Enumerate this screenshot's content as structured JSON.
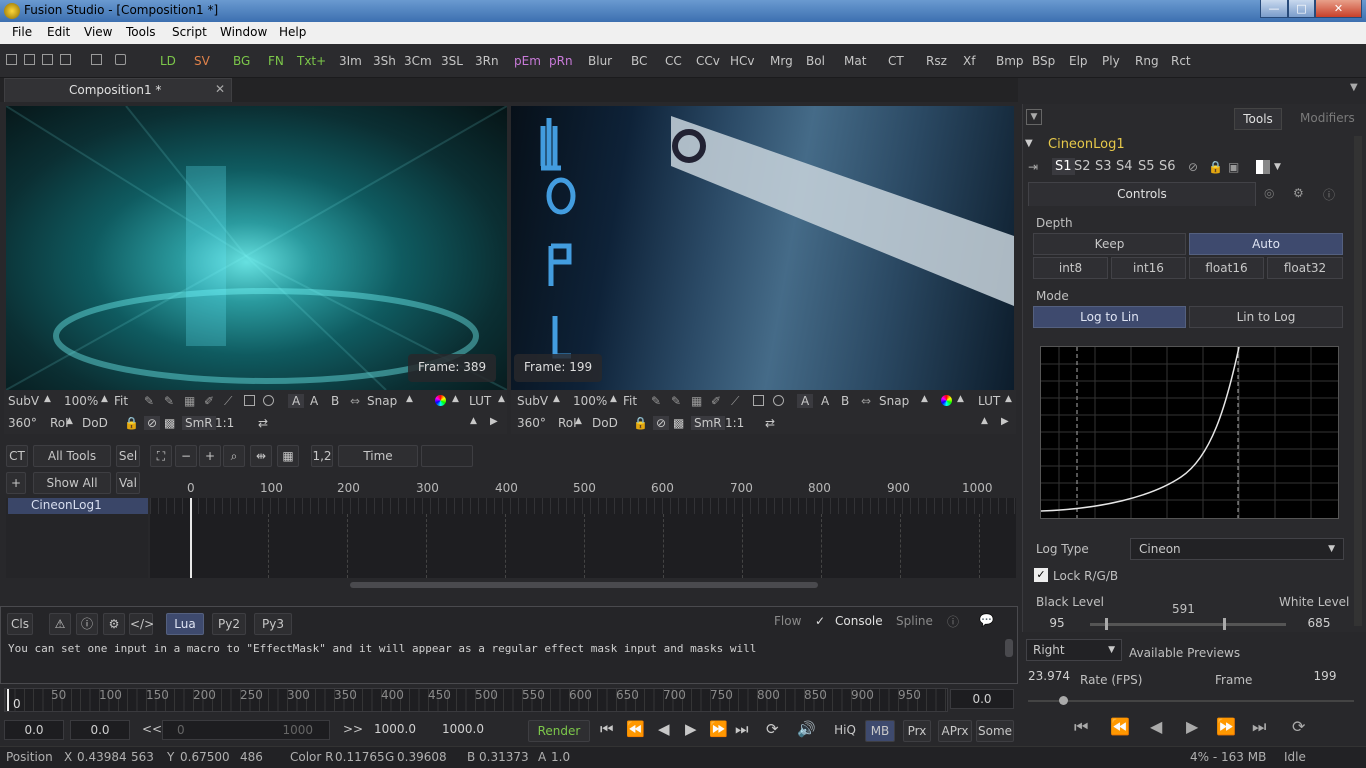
{
  "window": {
    "title": "Fusion Studio - [Composition1 *]",
    "minimize": "—",
    "maximize": "□",
    "close": "✕"
  },
  "menu": [
    "File",
    "Edit",
    "View",
    "Tools",
    "Script",
    "Window",
    "Help"
  ],
  "toolbar": {
    "tools": [
      {
        "label": "LD",
        "color": "#7cc74a"
      },
      {
        "label": "SV",
        "color": "#e0824a"
      },
      {
        "label": "BG",
        "color": "#7cc74a"
      },
      {
        "label": "FN",
        "color": "#7cc74a"
      },
      {
        "label": "Txt+",
        "color": "#7cc74a"
      },
      {
        "label": "3Im",
        "color": "#c6c6c6"
      },
      {
        "label": "3Sh",
        "color": "#c6c6c6"
      },
      {
        "label": "3Cm",
        "color": "#c6c6c6"
      },
      {
        "label": "3SL",
        "color": "#c6c6c6"
      },
      {
        "label": "3Rn",
        "color": "#c6c6c6"
      },
      {
        "label": "pEm",
        "color": "#c87ad8"
      },
      {
        "label": "pRn",
        "color": "#c87ad8"
      },
      {
        "label": "Blur",
        "color": "#c6c6c6"
      },
      {
        "label": "BC",
        "color": "#c6c6c6"
      },
      {
        "label": "CC",
        "color": "#c6c6c6"
      },
      {
        "label": "CCv",
        "color": "#c6c6c6"
      },
      {
        "label": "HCv",
        "color": "#c6c6c6"
      },
      {
        "label": "Mrg",
        "color": "#c6c6c6"
      },
      {
        "label": "Bol",
        "color": "#c6c6c6"
      },
      {
        "label": "Mat",
        "color": "#c6c6c6"
      },
      {
        "label": "CT",
        "color": "#c6c6c6"
      },
      {
        "label": "Rsz",
        "color": "#c6c6c6"
      },
      {
        "label": "Xf",
        "color": "#c6c6c6"
      },
      {
        "label": "Bmp",
        "color": "#c6c6c6"
      },
      {
        "label": "BSp",
        "color": "#c6c6c6"
      },
      {
        "label": "Elp",
        "color": "#c6c6c6"
      },
      {
        "label": "Ply",
        "color": "#c6c6c6"
      },
      {
        "label": "Rng",
        "color": "#c6c6c6"
      },
      {
        "label": "Rct",
        "color": "#c6c6c6"
      }
    ]
  },
  "tab": {
    "label": "Composition1 *",
    "close": "✕"
  },
  "viewer1": {
    "frame": "Frame: 389",
    "subv": "SubV",
    "zoom": "100%",
    "fit": "Fit",
    "snap": "Snap",
    "lut": "LUT",
    "deg": "360°",
    "roi": "RoI",
    "dod": "DoD",
    "smr": "SmR",
    "ratio": "1:1"
  },
  "viewer2": {
    "frame": "Frame: 199",
    "subv": "SubV",
    "zoom": "100%",
    "fit": "Fit",
    "snap": "Snap",
    "lut": "LUT",
    "deg": "360°",
    "roi": "RoI",
    "dod": "DoD",
    "smr": "SmR",
    "ratio": "1:1"
  },
  "timeline": {
    "ct": "CT",
    "all_tools": "All Tools",
    "sel": "Sel",
    "plus": "+",
    "show_all": "Show All",
    "val": "Val",
    "one_two": "1,2",
    "time": "Time",
    "ticks": [
      "0",
      "100",
      "200",
      "300",
      "400",
      "500",
      "600",
      "700",
      "800",
      "900",
      "1000"
    ],
    "node": "CineonLog1"
  },
  "console": {
    "cls": "Cls",
    "lua": "Lua",
    "py2": "Py2",
    "py3": "Py3",
    "flow": "Flow",
    "console": "Console",
    "spline": "Spline",
    "text": "You can set one input in a macro to \"EffectMask\" and it will appear as a regular effect mask input and masks will"
  },
  "ruler": {
    "ticks": [
      "0",
      "50",
      "100",
      "150",
      "200",
      "250",
      "300",
      "350",
      "400",
      "450",
      "500",
      "550",
      "600",
      "650",
      "700",
      "750",
      "800",
      "850",
      "900",
      "950"
    ],
    "value": "0.0"
  },
  "transport": {
    "start": "0.0",
    "render_start": "0.0",
    "range_start": "0",
    "range_end": "1000",
    "render_end": "1000.0",
    "end": "1000.0",
    "render": "Render",
    "hiq": "HiQ",
    "mb": "MB",
    "prx": "Prx",
    "aprx": "APrx",
    "some": "Some"
  },
  "status": {
    "position": "Position",
    "x_label": "X",
    "x": "0.43984",
    "x_px": "563",
    "y_label": "Y",
    "y": "0.67500",
    "y_px": "486",
    "color_r_label": "Color R",
    "r": "0.11765",
    "g_label": "G",
    "g": "0.39608",
    "b_label": "B",
    "b": "0.31373",
    "a_label": "A",
    "a": "1.0",
    "mem": "4% - 163 MB",
    "state": "Idle"
  },
  "inspector": {
    "tabs": [
      "Tools",
      "Modifiers"
    ],
    "tool_name": "CineonLog1",
    "slots": [
      "S1",
      "S2",
      "S3",
      "S4",
      "S5",
      "S6"
    ],
    "controls": "Controls",
    "depth_label": "Depth",
    "depth_opts": [
      "Keep",
      "Auto",
      "int8",
      "int16",
      "float16",
      "float32"
    ],
    "depth_selected": "Auto",
    "mode_label": "Mode",
    "mode_opts": [
      "Log to Lin",
      "Lin to Log"
    ],
    "mode_selected": "Log to Lin",
    "log_type_label": "Log Type",
    "log_type": "Cineon",
    "lock_rgb": "Lock R/G/B",
    "lock_checked": true,
    "black_label": "Black Level",
    "white_label": "White Level",
    "mid_value": "591",
    "black": "95",
    "white": "685"
  },
  "previews": {
    "side": "Right",
    "label": "Available Previews",
    "fps": "23.974",
    "rate_label": "Rate (FPS)",
    "frame_label": "Frame",
    "frame": "199"
  }
}
